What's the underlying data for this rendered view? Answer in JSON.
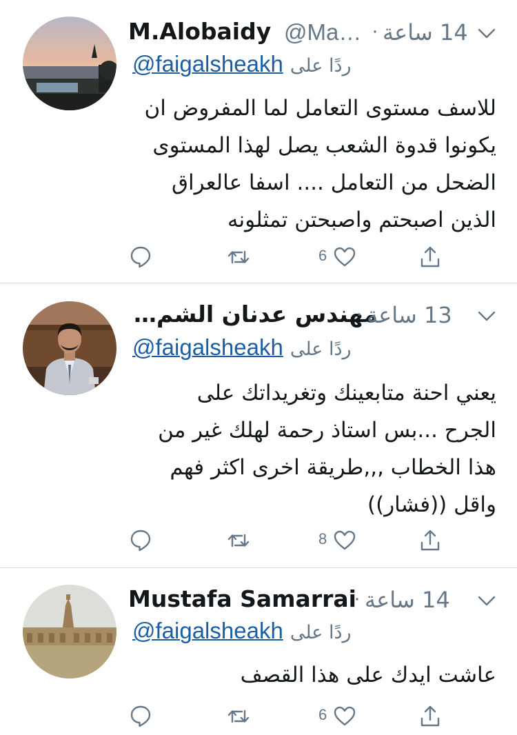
{
  "tweets": [
    {
      "author": "M.Alobaidy",
      "handle": "@Ma…",
      "time": "14 ساعة",
      "replying_to_label": "ردًا على",
      "mention": "@faigalsheakh",
      "lines": [
        "للاسف مستوى التعامل لما المفروض ان",
        "يكونوا قدوة الشعب يصل لهذا المستوى",
        "الضحل من التعامل .... اسفا عالعراق",
        "الذين اصبحتم واصبحتن تمثلونه"
      ],
      "likes": "6",
      "avatar_icon": "sunset-landscape"
    },
    {
      "author": "مهندس عدنان الشم…",
      "handle": "",
      "time": "13 ساعة",
      "replying_to_label": "ردًا على",
      "mention": "@faigalsheakh",
      "lines": [
        "يعني احنة متابعينك وتغريداتك على",
        "الجرح ...بس استاذ رحمة لهلك غير من",
        "هذا الخطاب ,,,طريقة اخرى اكثر فهم",
        "واقل ((فشار))"
      ],
      "likes": "8",
      "avatar_icon": "man-in-suit"
    },
    {
      "author": "Mustafa Samarrai",
      "handle": "",
      "time": "14 ساعة",
      "replying_to_label": "ردًا على",
      "mention": "@faigalsheakh",
      "lines": [
        "عاشت ايدك على هذا القصف"
      ],
      "likes": "6",
      "avatar_icon": "minaret-landscape"
    }
  ],
  "colors": {
    "text": "#14171a",
    "muted": "#657786",
    "link": "#1b5ea5",
    "separator": "#d5dbe0"
  },
  "icons": [
    "reply-icon",
    "retweet-icon",
    "like-icon",
    "share-icon",
    "chevron-down-icon"
  ]
}
